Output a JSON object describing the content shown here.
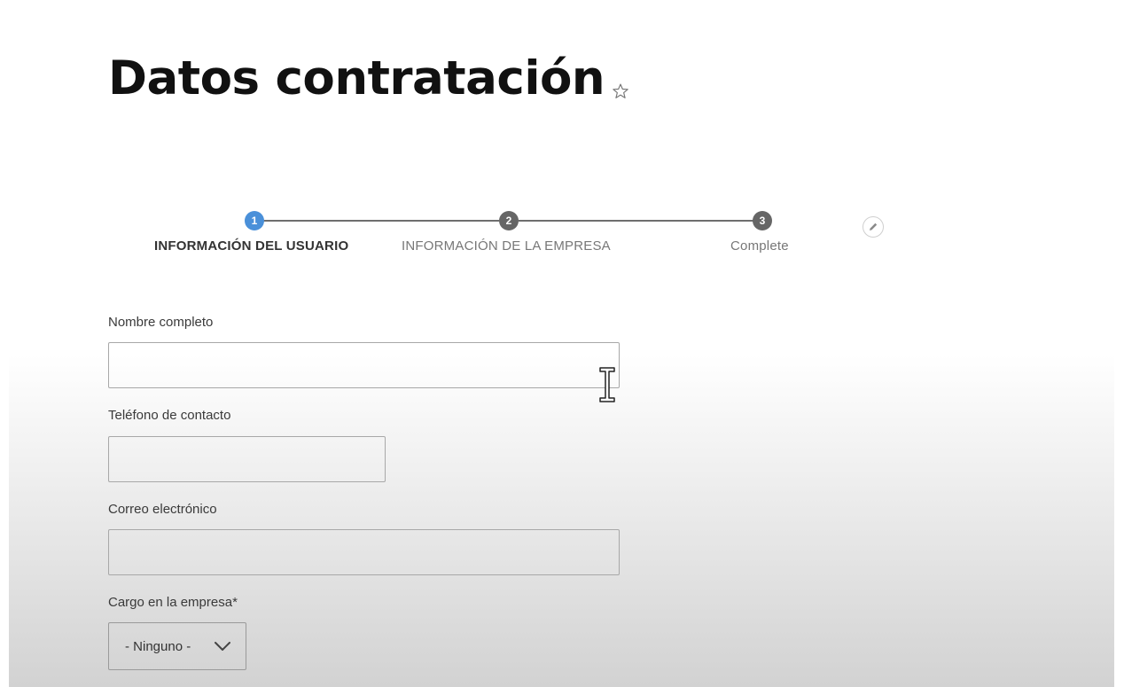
{
  "header": {
    "title": "Datos contratación",
    "favorite_icon": "star-outline-icon"
  },
  "stepper": {
    "steps": [
      {
        "number": "1",
        "label": "INFORMACIÓN DEL USUARIO",
        "state": "active"
      },
      {
        "number": "2",
        "label": "INFORMACIÓN DE LA EMPRESA",
        "state": "inactive"
      },
      {
        "number": "3",
        "label": "Complete",
        "state": "inactive"
      }
    ],
    "edit_icon": "pencil-icon"
  },
  "form": {
    "full_name": {
      "label": "Nombre completo",
      "value": "",
      "placeholder": ""
    },
    "phone": {
      "label": "Teléfono de contacto",
      "value": "",
      "placeholder": ""
    },
    "email": {
      "label": "Correo electrónico",
      "value": "",
      "placeholder": ""
    },
    "position": {
      "label": "Cargo en la empresa*",
      "selected": "- Ninguno -"
    }
  },
  "cursor": "text-cursor-icon",
  "colors": {
    "active_step": "#4a90d9",
    "inactive_step": "#666666",
    "title": "#111111"
  }
}
